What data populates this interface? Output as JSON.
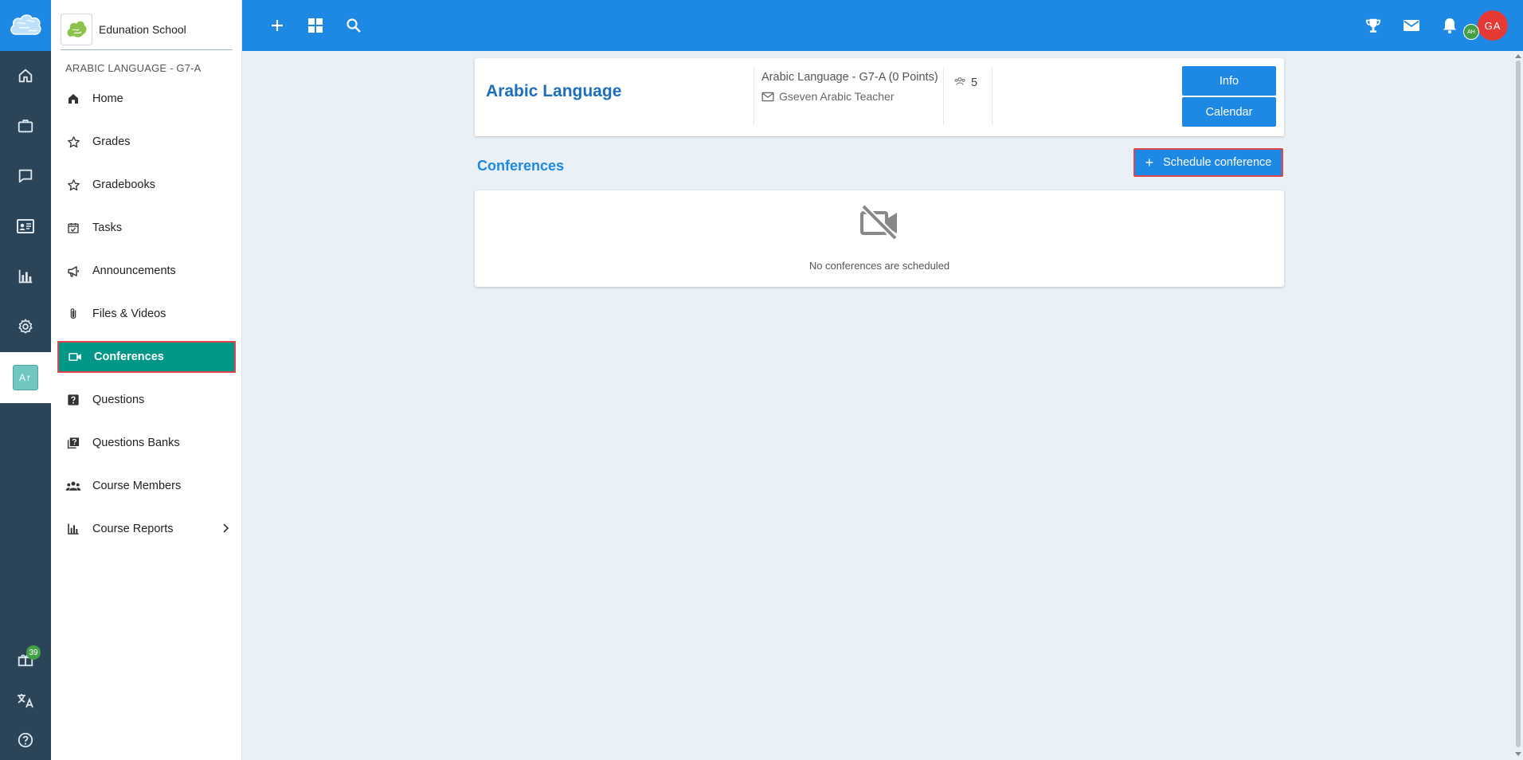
{
  "school": {
    "name": "Edunation School"
  },
  "course": {
    "code": "ARABIC LANGUAGE - G7-A",
    "title": "Arabic Language",
    "points_line": "Arabic Language - G7-A (0 Points)",
    "teacher": "Gseven Arabic Teacher",
    "members_count": "5",
    "info_label": "Info",
    "calendar_label": "Calendar"
  },
  "rail": {
    "course_initials": "Ar",
    "gift_badge": "39"
  },
  "sidebar": {
    "items": [
      {
        "label": "Home",
        "icon": "home-icon"
      },
      {
        "label": "Grades",
        "icon": "star-icon"
      },
      {
        "label": "Gradebooks",
        "icon": "star-icon"
      },
      {
        "label": "Tasks",
        "icon": "calendar-check-icon"
      },
      {
        "label": "Announcements",
        "icon": "megaphone-icon"
      },
      {
        "label": "Files & Videos",
        "icon": "paperclip-icon"
      },
      {
        "label": "Conferences",
        "icon": "video-icon",
        "active": true
      },
      {
        "label": "Questions",
        "icon": "question-icon"
      },
      {
        "label": "Questions Banks",
        "icon": "question-bank-icon"
      },
      {
        "label": "Course Members",
        "icon": "people-icon"
      },
      {
        "label": "Course Reports",
        "icon": "bar-chart-icon"
      }
    ]
  },
  "topbar": {
    "avatar_main": "GA",
    "avatar_secondary": "AH"
  },
  "conferences": {
    "title": "Conferences",
    "schedule_label": "Schedule conference",
    "empty_text": "No conferences are scheduled"
  },
  "colors": {
    "primary": "#1e88e5",
    "active_nav": "#009688",
    "rail": "#2b4457",
    "highlight_border": "#e0474c"
  }
}
